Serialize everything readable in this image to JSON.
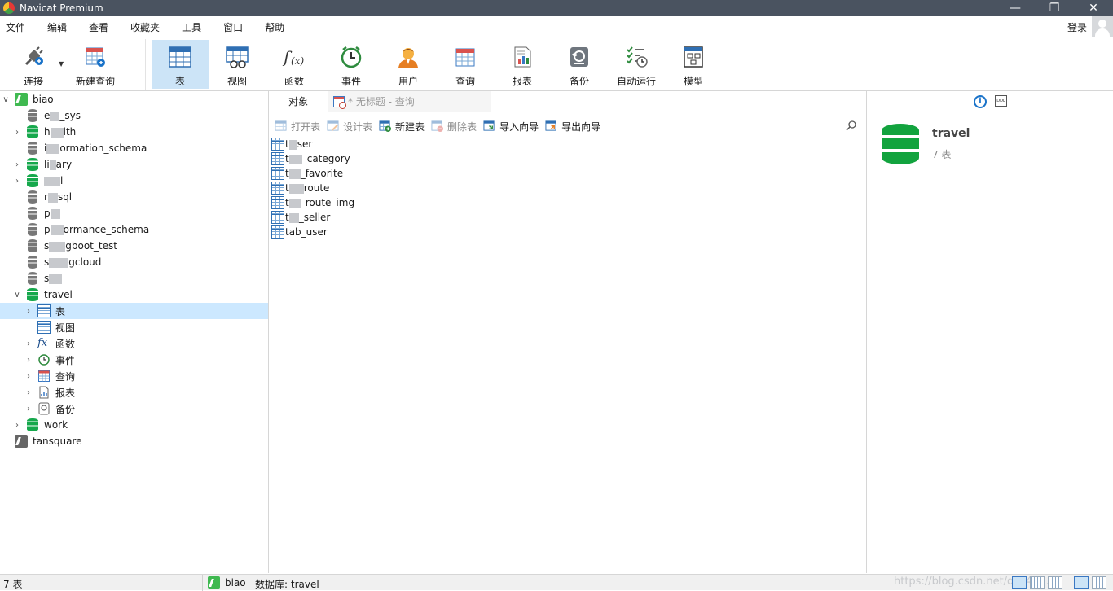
{
  "window": {
    "title": "Navicat Premium",
    "controls": [
      "—",
      "❐",
      "✕"
    ]
  },
  "menu": {
    "items": [
      "文件",
      "编辑",
      "查看",
      "收藏夹",
      "工具",
      "窗口",
      "帮助"
    ],
    "login": "登录"
  },
  "toolbar": {
    "buttons": [
      {
        "label": "连接",
        "icon": "plug-icon"
      },
      {
        "label": "新建查询",
        "icon": "new-query-icon"
      },
      {
        "label": "表",
        "icon": "table-icon",
        "active": true
      },
      {
        "label": "视图",
        "icon": "view-icon"
      },
      {
        "label": "函数",
        "icon": "function-icon"
      },
      {
        "label": "事件",
        "icon": "clock-icon"
      },
      {
        "label": "用户",
        "icon": "user-icon"
      },
      {
        "label": "查询",
        "icon": "query-icon"
      },
      {
        "label": "报表",
        "icon": "report-icon"
      },
      {
        "label": "备份",
        "icon": "backup-icon"
      },
      {
        "label": "自动运行",
        "icon": "schedule-icon"
      },
      {
        "label": "模型",
        "icon": "model-icon"
      }
    ]
  },
  "tree": {
    "conn_biao": "biao",
    "db_items": [
      "_sys",
      "lth",
      "ormation_schema",
      "ary",
      "",
      "sql",
      "",
      "ormance_schema",
      "gboot_test",
      "gcloud",
      ""
    ],
    "travel": "travel",
    "travel_children": [
      "表",
      "视图",
      "函数",
      "事件",
      "查询",
      "报表",
      "备份"
    ],
    "work": "work",
    "conn_tansquare": "tansquare"
  },
  "tabs": {
    "objects": "对象",
    "query": "* 无标题 - 查询"
  },
  "objbar": {
    "open": "打开表",
    "design": "设计表",
    "new": "新建表",
    "delete": "删除表",
    "import": "导入向导",
    "export": "导出向导"
  },
  "tables": [
    "ser",
    "_category",
    "_favorite",
    "route",
    "_route_img",
    "_seller",
    "tab_user"
  ],
  "info": {
    "db_name": "travel",
    "table_count": "7 表"
  },
  "status": {
    "count": "7 表",
    "connection": "biao",
    "database": "数据库: travel",
    "watermark": "https://blog.csdn.net/qq_45..."
  }
}
